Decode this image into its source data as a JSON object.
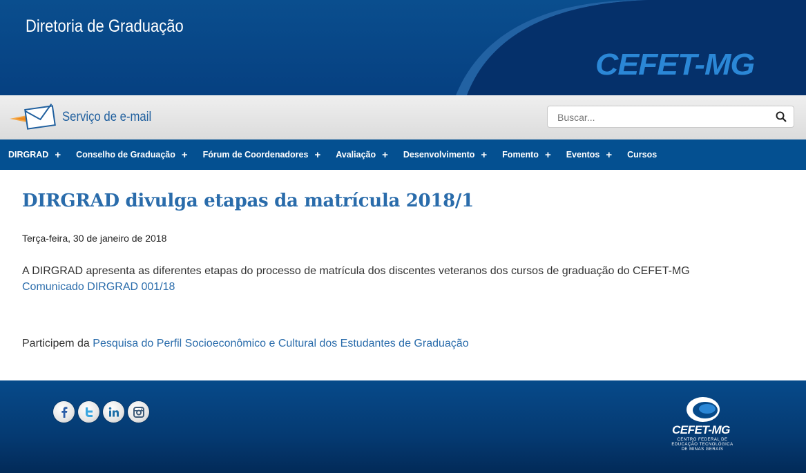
{
  "header": {
    "site_title": "Diretoria de Graduação",
    "logo_text": "CEFET-MG"
  },
  "subbar": {
    "email_label": "Serviço de e-mail",
    "search_placeholder": "Buscar..."
  },
  "nav": [
    {
      "label": "DIRGRAD",
      "has_submenu": true
    },
    {
      "label": "Conselho de Graduação",
      "has_submenu": true
    },
    {
      "label": "Fórum de Coordenadores",
      "has_submenu": true
    },
    {
      "label": "Avaliação",
      "has_submenu": true
    },
    {
      "label": "Desenvolvimento",
      "has_submenu": true
    },
    {
      "label": "Fomento",
      "has_submenu": true
    },
    {
      "label": "Eventos",
      "has_submenu": true
    },
    {
      "label": "Cursos",
      "has_submenu": false
    }
  ],
  "nav_plus": "+",
  "article": {
    "title": "DIRGRAD divulga etapas da matrícula 2018/1",
    "date": "Terça-feira, 30 de janeiro de 2018",
    "paragraph1": "A DIRGRAD apresenta as diferentes etapas do processo de matrícula dos discentes veteranos dos cursos de graduação do CEFET-MG",
    "link1": "Comunicado DIRGRAD 001/18",
    "paragraph2_prefix": "Participem da ",
    "link2": "Pesquisa do Perfil Socioeconômico e Cultural dos Estudantes de Graduação"
  },
  "footer": {
    "social": [
      "facebook-icon",
      "twitter-icon",
      "linkedin-icon",
      "instagram-icon"
    ],
    "logo_text": "CEFET-MG",
    "logo_subtext_1": "CENTRO FEDERAL DE",
    "logo_subtext_2": "EDUCAÇÃO TECNOLÓGICA",
    "logo_subtext_3": "DE MINAS GERAIS"
  },
  "colors": {
    "brand_blue": "#045091",
    "link_blue": "#2a6cab",
    "logo_blue": "#2b87d6"
  }
}
